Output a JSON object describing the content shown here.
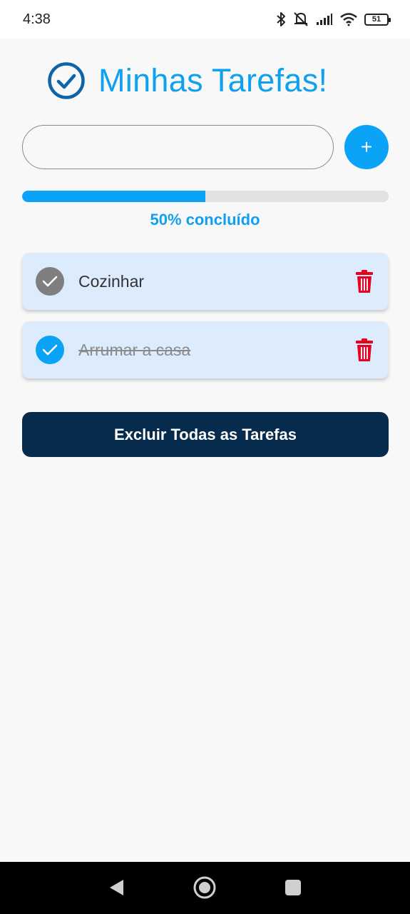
{
  "status_bar": {
    "time": "4:38",
    "battery": "51",
    "icons": [
      "bluetooth-icon",
      "vibrate-off-icon",
      "signal-icon",
      "wifi-icon",
      "battery-icon"
    ]
  },
  "header": {
    "title": "Minhas Tarefas!",
    "icon": "check-circle-icon"
  },
  "input": {
    "value": "",
    "placeholder": ""
  },
  "add_button": {
    "label": "+"
  },
  "progress": {
    "fraction": 0.5,
    "label": "50% concluído"
  },
  "tasks": [
    {
      "label": "Cozinhar",
      "done": false
    },
    {
      "label": "Arrumar a casa",
      "done": true
    }
  ],
  "clear_button": {
    "label": "Excluir Todas as Tarefas"
  },
  "colors": {
    "accent": "#0aa3f5",
    "title": "#10a0f0",
    "task_bg": "#dcecfc",
    "delete": "#e8001c",
    "clear_button_bg": "#062b4d",
    "unchecked": "#7f7f7f"
  }
}
